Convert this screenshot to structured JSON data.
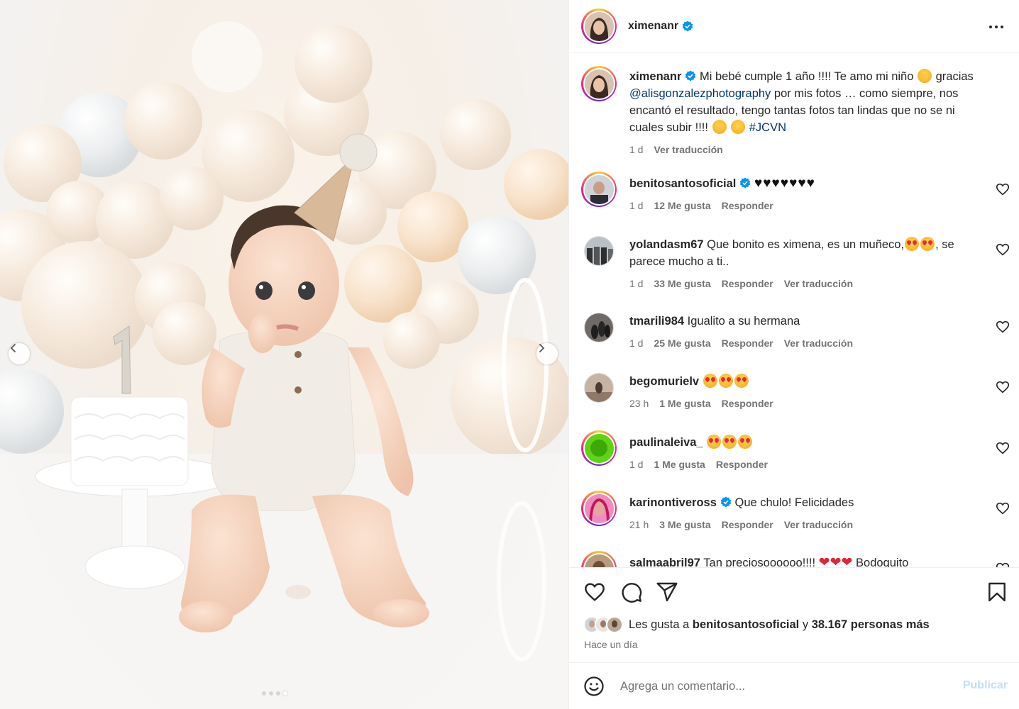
{
  "post": {
    "author": "ximenanr",
    "caption_text_1": "Mi bebé cumple 1 año !!!! Te amo mi niño",
    "caption_text_2": "gracias",
    "caption_mention": "@alisgonzalezphotography",
    "caption_text_3": "por mis fotos … como siempre, nos encantó el resultado, tengo tantas fotos tan lindas que no se ni cuales subir !!!!",
    "caption_hashtag": "#JCVN",
    "caption_time": "1 d",
    "caption_translate": "Ver traducción"
  },
  "comments": [
    {
      "user": "benitosantosoficial",
      "verified": true,
      "text": "♥♥♥♥♥♥♥",
      "time": "1 d",
      "likes": "12 Me gusta",
      "reply": "Responder",
      "translate": ""
    },
    {
      "user": "yolandasm67",
      "verified": false,
      "text_1": "Que bonito es ximena, es un muñeco,",
      "text_2": ", se parece mucho a ti..",
      "time": "1 d",
      "likes": "33 Me gusta",
      "reply": "Responder",
      "translate": "Ver traducción"
    },
    {
      "user": "tmarili984",
      "verified": false,
      "text": "Igualito a su hermana",
      "time": "1 d",
      "likes": "25 Me gusta",
      "reply": "Responder",
      "translate": "Ver traducción"
    },
    {
      "user": "begomurielv",
      "verified": false,
      "text": "",
      "time": "23 h",
      "likes": "1 Me gusta",
      "reply": "Responder",
      "translate": ""
    },
    {
      "user": "paulinaleiva_",
      "verified": false,
      "text": "",
      "time": "1 d",
      "likes": "1 Me gusta",
      "reply": "Responder",
      "translate": ""
    },
    {
      "user": "karinontiveross",
      "verified": true,
      "text": "Que chulo! Felicidades",
      "time": "21 h",
      "likes": "3 Me gusta",
      "reply": "Responder",
      "translate": "Ver traducción"
    },
    {
      "user": "salmaabril97",
      "verified": false,
      "text_1": "Tan preciosoooooo!!!!",
      "text_2": "Bodoquito",
      "time": "",
      "likes": "",
      "reply": "",
      "translate": ""
    }
  ],
  "likes_bar": {
    "prefix": "Les gusta a",
    "liker": "benitosantosoficial",
    "joiner": "y",
    "others": "38.167 personas más",
    "time_ago": "Hace un día"
  },
  "composer": {
    "placeholder": "Agrega un comentario...",
    "publish_label": "Publicar"
  },
  "carousel": {
    "slide_count": 4,
    "active_slide": 4
  },
  "colors": {
    "mention": "#00376b",
    "verified": "#0095f6",
    "publish_disabled": "#c0dffd",
    "muted": "#737373"
  },
  "icons": [
    "chevron-left-icon",
    "chevron-right-icon",
    "more-icon",
    "verified-badge-icon",
    "heart-icon",
    "comment-icon",
    "share-icon",
    "bookmark-icon",
    "emoji-icon"
  ]
}
